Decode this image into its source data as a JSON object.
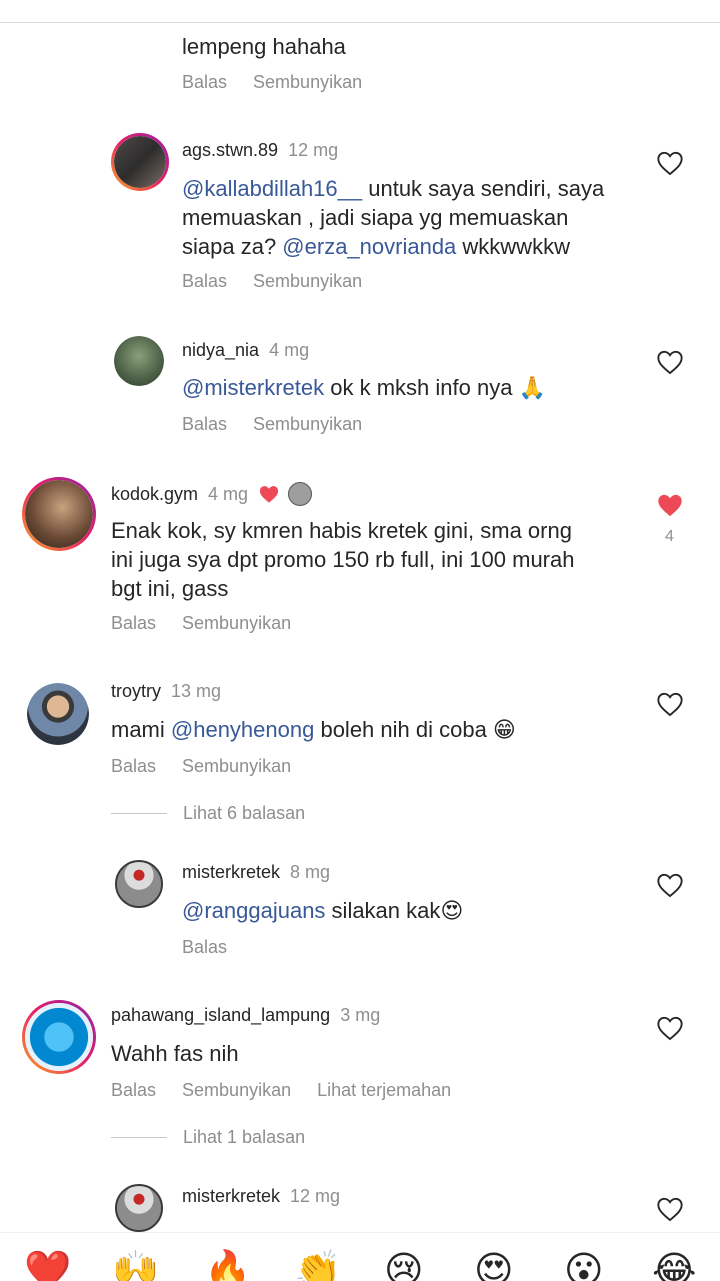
{
  "ui": {
    "reply_label": "Balas",
    "hide_label": "Sembunyikan",
    "translate_label": "Lihat terjemahan"
  },
  "partial_top": {
    "text_line": "lempeng hahaha"
  },
  "comments": [
    {
      "username": "ags.stwn.89",
      "time": "12 mg",
      "text_parts": [
        "@kallabdillah16__",
        " untuk saya sendiri, saya",
        "memuaskan , jadi siapa yg memuaskan",
        "siapa za? ",
        "@erza_novrianda",
        " wkkwwkkw"
      ]
    },
    {
      "username": "nidya_nia",
      "time": "4 mg",
      "mention": "@misterkretek",
      "text": " ok k mksh info nya 🙏"
    },
    {
      "username": "kodok.gym",
      "time": "4 mg",
      "lines": [
        "Enak kok, sy kmren habis kretek gini, sma orng",
        "ini juga sya dpt promo 150 rb full, ini 100 murah",
        "bgt ini, gass"
      ],
      "likes": "4"
    },
    {
      "username": "troytry",
      "time": "13 mg",
      "pre": "mami ",
      "mention": "@henyhenong",
      "post": " boleh nih di coba 😁",
      "view_replies": "Lihat 6 balasan"
    },
    {
      "username": "misterkretek",
      "time": "8 mg",
      "mention": "@ranggajuans",
      "post": " silakan kak😍"
    },
    {
      "username": "pahawang_island_lampung",
      "time": "3 mg",
      "text": "Wahh fas nih",
      "view_replies": "Lihat 1 balasan"
    },
    {
      "username": "misterkretek",
      "time": "12 mg"
    }
  ],
  "colors": {
    "text": "#262626",
    "meta": "#8e8e8e",
    "mention": "#385898",
    "liked": "#ed4956"
  },
  "emoji_bar": [
    "❤️",
    "🙌",
    "🔥",
    "👏",
    "😢",
    "😍",
    "😮",
    "😂"
  ]
}
